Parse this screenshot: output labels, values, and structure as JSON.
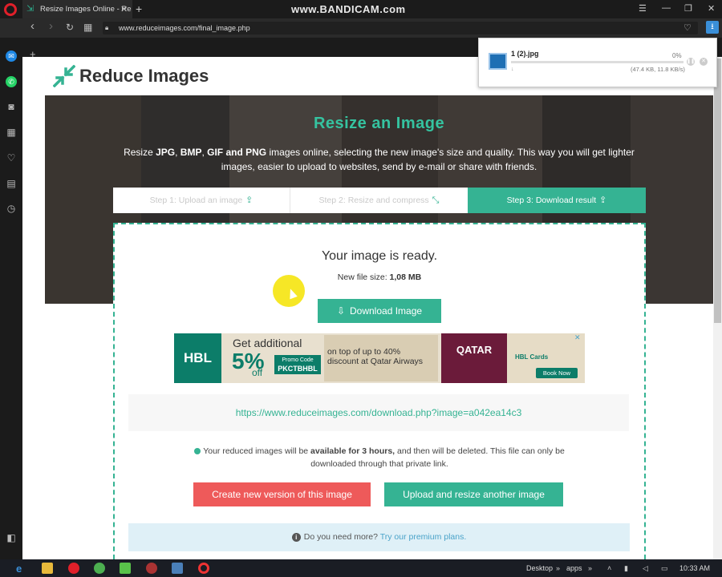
{
  "browser": {
    "tab_title": "Resize Images Online - Re",
    "tab_close": "✕",
    "new_tab": "+",
    "watermark": "www.BANDICAM.com",
    "url": "www.reduceimages.com/final_image.php",
    "back": "‹",
    "forward": "›",
    "reload": "↻",
    "speed_dial": "▦",
    "win_menu": "☰",
    "win_min": "—",
    "win_max": "❐",
    "win_close": "✕"
  },
  "download_popup": {
    "file_name": "1 (2).jpg",
    "percent": "0%",
    "size_info": "(47.4 KB, 11.8 KB/s)",
    "progress": 0
  },
  "site": {
    "logo_text": "Reduce Images",
    "hero_title": "Resize an Image",
    "hero_desc_parts": [
      "Resize ",
      "JPG",
      ", ",
      "BMP",
      ", ",
      "GIF and PNG",
      " images online, selecting the new image's size and quality. This way you will get lighter images, easier to upload to websites, send by e-mail or share with friends."
    ],
    "steps": [
      {
        "label": "Step 1: Upload an image",
        "active": false
      },
      {
        "label": "Step 2: Resize and compress",
        "active": false
      },
      {
        "label": "Step 3: Download result",
        "active": true
      }
    ]
  },
  "result": {
    "ready_text": "Your image is ready.",
    "file_size_label": "New file size:",
    "file_size_value": "1,08 MB",
    "download_button": "Download Image",
    "download_link": "https://www.reduceimages.com/download.php?image=a042ea14c3",
    "note_parts": [
      "Your reduced images will be ",
      "available for 3 hours,",
      " and then will be deleted. This file can only be downloaded through that private link."
    ],
    "create_button": "Create new version of this image",
    "upload_button": "Upload and resize another image",
    "premium_text": "Do you need more?",
    "premium_link": "Try our premium plans."
  },
  "ad": {
    "brand": "HBL",
    "get": "Get additional",
    "percent": "5%",
    "off": "off",
    "promo_label": "Promo Code",
    "promo_code": "PKCTBHBL",
    "mid_text": "on top of up to 40% discount at Qatar Airways",
    "qatar": "QATAR",
    "cards": "HBL Cards",
    "book_now": "Book Now",
    "close": "✕"
  },
  "taskbar": {
    "desktop": "Desktop",
    "apps": "apps",
    "time": "10:33 AM"
  },
  "colors": {
    "accent": "#35b393",
    "title": "#35c3a0",
    "danger": "#ee5a5a",
    "info_bg": "#dff0f7"
  }
}
